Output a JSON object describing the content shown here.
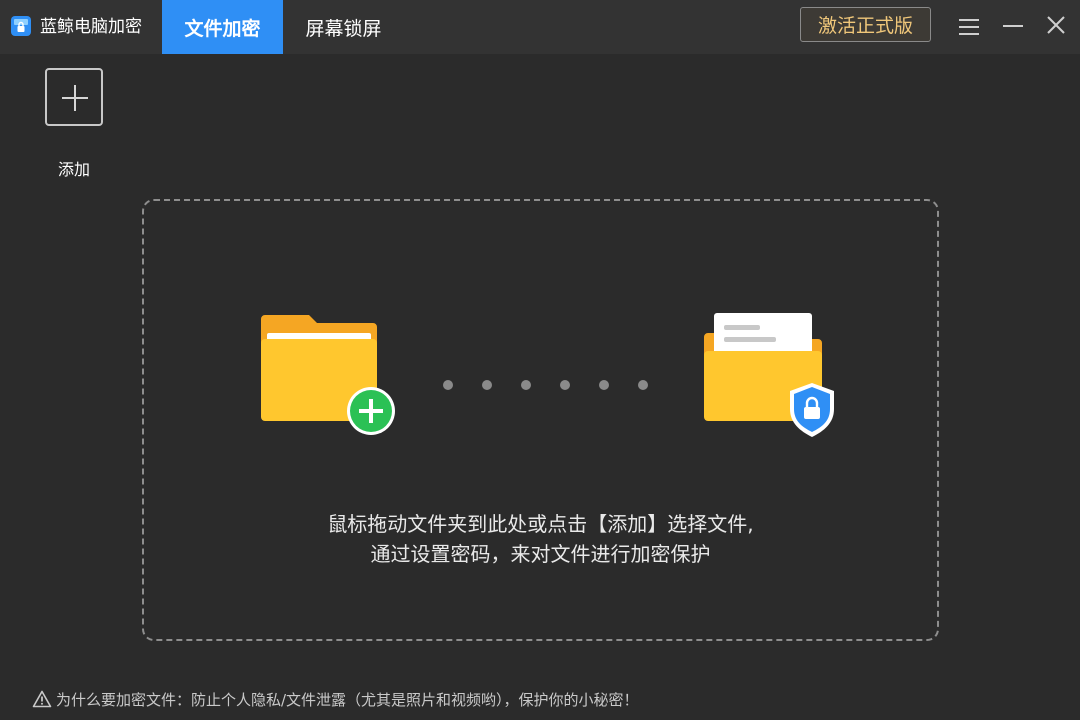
{
  "app": {
    "title": "蓝鲸电脑加密"
  },
  "tabs": [
    {
      "label": "文件加密",
      "active": true
    },
    {
      "label": "屏幕锁屏",
      "active": false
    }
  ],
  "header": {
    "activate_label": "激活正式版"
  },
  "toolbar": {
    "add_label": "添加"
  },
  "dropzone": {
    "line1": "鼠标拖动文件夹到此处或点击【添加】选择文件,",
    "line2": "通过设置密码，来对文件进行加密保护"
  },
  "footer": {
    "tip": "为什么要加密文件：防止个人隐私/文件泄露（尤其是照片和视频哟），保护你的小秘密！"
  },
  "colors": {
    "accent": "#2f8ff5",
    "activate_text": "#f0c77a",
    "folder_yellow": "#ffc72e",
    "plus_green": "#2bc155",
    "shield_blue": "#2f8ff5"
  },
  "icons": {
    "brand": "lock-app-icon",
    "menu": "hamburger-icon",
    "minimize": "minimize-icon",
    "close": "close-icon",
    "add": "plus-icon",
    "source_folder": "folder-add-icon",
    "target_folder": "folder-lock-icon",
    "warning": "warning-icon"
  }
}
